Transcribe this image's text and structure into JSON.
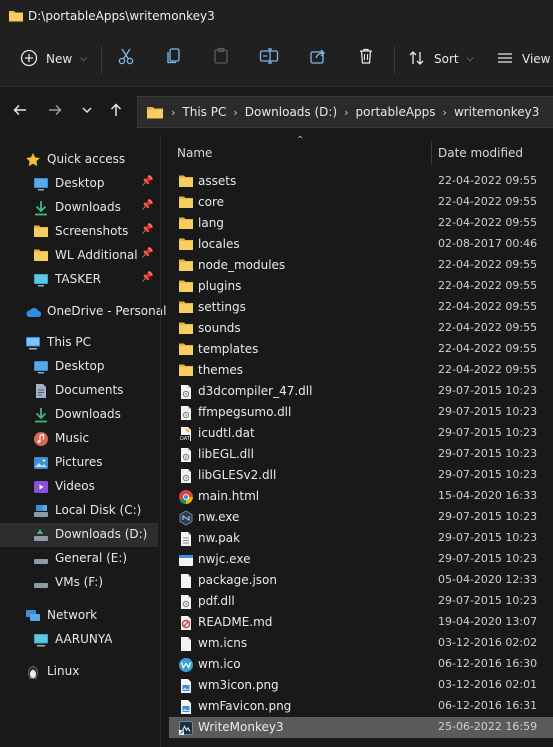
{
  "window": {
    "title": "D:\\portableApps\\writemonkey3"
  },
  "toolbar": {
    "new_label": "New",
    "sort_label": "Sort",
    "view_label": "View"
  },
  "address": {
    "crumbs": [
      "This PC",
      "Downloads (D:)",
      "portableApps",
      "writemonkey3"
    ]
  },
  "sidebar": {
    "items": [
      {
        "label": "Quick access"
      },
      {
        "label": "Desktop"
      },
      {
        "label": "Downloads"
      },
      {
        "label": "Screenshots"
      },
      {
        "label": "WL Additional A"
      },
      {
        "label": "TASKER"
      },
      {
        "label": "OneDrive - Personal"
      },
      {
        "label": "This PC"
      },
      {
        "label": "Desktop"
      },
      {
        "label": "Documents"
      },
      {
        "label": "Downloads"
      },
      {
        "label": "Music"
      },
      {
        "label": "Pictures"
      },
      {
        "label": "Videos"
      },
      {
        "label": "Local Disk (C:)"
      },
      {
        "label": "Downloads (D:)"
      },
      {
        "label": "General (E:)"
      },
      {
        "label": "VMs (F:)"
      },
      {
        "label": "Network"
      },
      {
        "label": "AARUNYA"
      },
      {
        "label": "Linux"
      }
    ]
  },
  "columns": {
    "name": "Name",
    "date": "Date modified"
  },
  "files": [
    {
      "name": "assets",
      "date": "22-04-2022 09:55",
      "icon": "folder-icon"
    },
    {
      "name": "core",
      "date": "22-04-2022 09:55",
      "icon": "folder-icon"
    },
    {
      "name": "lang",
      "date": "22-04-2022 09:55",
      "icon": "folder-icon"
    },
    {
      "name": "locales",
      "date": "02-08-2017 00:46",
      "icon": "folder-icon"
    },
    {
      "name": "node_modules",
      "date": "22-04-2022 09:55",
      "icon": "folder-icon"
    },
    {
      "name": "plugins",
      "date": "22-04-2022 09:55",
      "icon": "folder-icon"
    },
    {
      "name": "settings",
      "date": "22-04-2022 09:55",
      "icon": "folder-icon"
    },
    {
      "name": "sounds",
      "date": "22-04-2022 09:55",
      "icon": "folder-icon"
    },
    {
      "name": "templates",
      "date": "22-04-2022 09:55",
      "icon": "folder-icon"
    },
    {
      "name": "themes",
      "date": "22-04-2022 09:55",
      "icon": "folder-icon"
    },
    {
      "name": "d3dcompiler_47.dll",
      "date": "29-07-2015 10:23",
      "icon": "dll-file-icon"
    },
    {
      "name": "ffmpegsumo.dll",
      "date": "29-07-2015 10:23",
      "icon": "dll-file-icon"
    },
    {
      "name": "icudtl.dat",
      "date": "29-07-2015 10:23",
      "icon": "dat-file-icon"
    },
    {
      "name": "libEGL.dll",
      "date": "29-07-2015 10:23",
      "icon": "dll-file-icon"
    },
    {
      "name": "libGLESv2.dll",
      "date": "29-07-2015 10:23",
      "icon": "dll-file-icon"
    },
    {
      "name": "main.html",
      "date": "15-04-2020 16:33",
      "icon": "chrome-html-icon"
    },
    {
      "name": "nw.exe",
      "date": "29-07-2015 10:23",
      "icon": "nw-exe-icon"
    },
    {
      "name": "nw.pak",
      "date": "29-07-2015 10:23",
      "icon": "pak-file-icon"
    },
    {
      "name": "nwjc.exe",
      "date": "29-07-2015 10:23",
      "icon": "exe-file-icon"
    },
    {
      "name": "package.json",
      "date": "05-04-2020 12:33",
      "icon": "json-file-icon"
    },
    {
      "name": "pdf.dll",
      "date": "29-07-2015 10:23",
      "icon": "dll-file-icon"
    },
    {
      "name": "README.md",
      "date": "19-04-2020 13:07",
      "icon": "md-file-icon"
    },
    {
      "name": "wm.icns",
      "date": "03-12-2016 02:02",
      "icon": "generic-file-icon"
    },
    {
      "name": "wm.ico",
      "date": "06-12-2016 16:30",
      "icon": "wm-ico-icon"
    },
    {
      "name": "wm3icon.png",
      "date": "03-12-2016 02:01",
      "icon": "image-file-icon"
    },
    {
      "name": "wmFavicon.png",
      "date": "06-12-2016 16:31",
      "icon": "image-file-icon"
    },
    {
      "name": "WriteMonkey3",
      "date": "25-06-2022 16:59",
      "icon": "shortcut-icon",
      "selected": true
    }
  ]
}
